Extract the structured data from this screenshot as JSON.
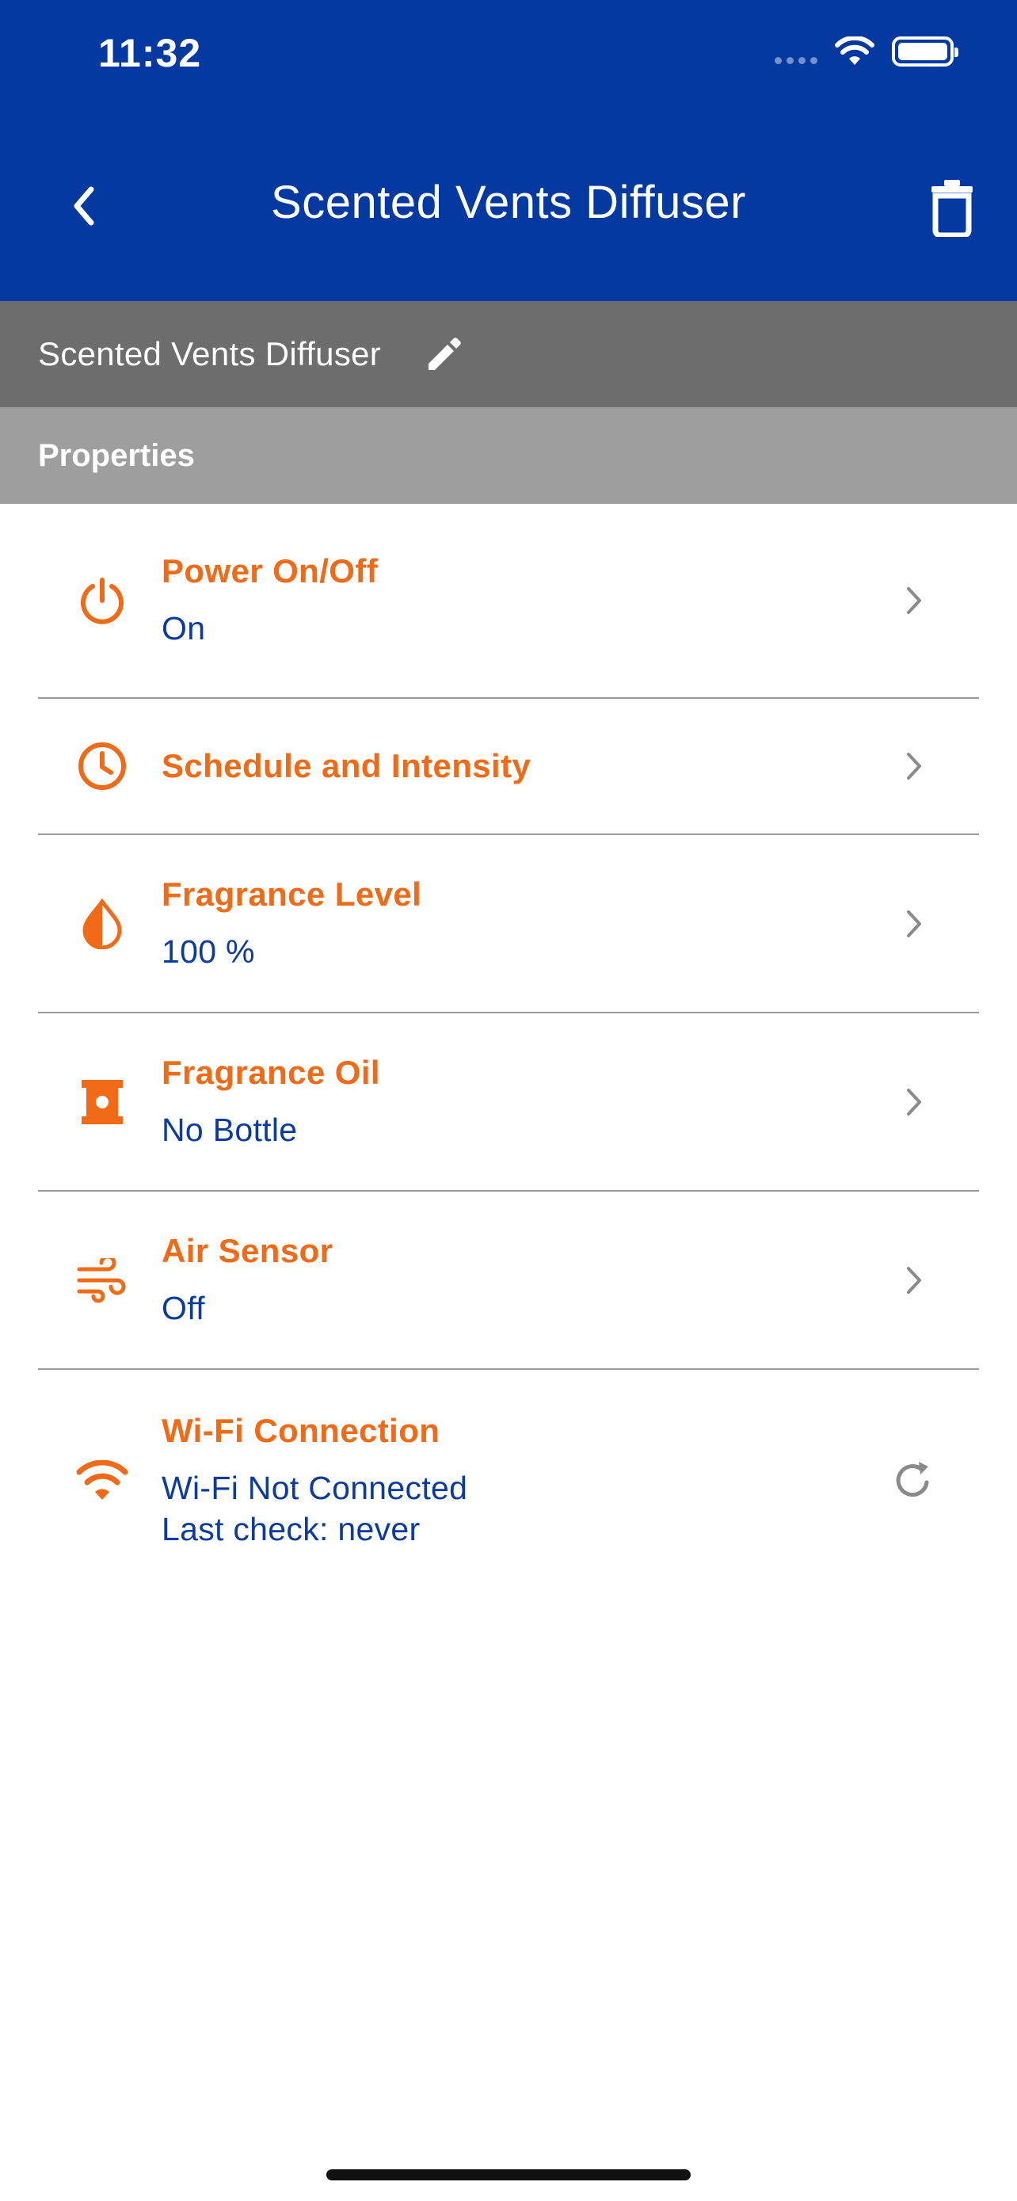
{
  "status_bar": {
    "time": "11:32"
  },
  "header": {
    "title": "Scented Vents Diffuser"
  },
  "device": {
    "name": "Scented Vents Diffuser"
  },
  "section": {
    "title": "Properties"
  },
  "properties": [
    {
      "title": "Power On/Off",
      "value": "On",
      "icon": "power-icon"
    },
    {
      "title": "Schedule and Intensity",
      "icon": "clock-icon"
    },
    {
      "title": "Fragrance Level",
      "value": "100 %",
      "icon": "drop-icon"
    },
    {
      "title": "Fragrance Oil",
      "value": "No Bottle",
      "icon": "bottle-icon"
    },
    {
      "title": "Air Sensor",
      "value": "Off",
      "icon": "wind-icon"
    },
    {
      "title": "Wi-Fi Connection",
      "value": "Wi-Fi Not Connected",
      "value2": "Last check: never",
      "icon": "wifi-icon"
    }
  ],
  "colors": {
    "header": "#0339a0",
    "accent": "#f06a17",
    "value": "#0b3aa0",
    "name_bar": "#6d6d6d",
    "section_bar": "#9e9e9e"
  }
}
